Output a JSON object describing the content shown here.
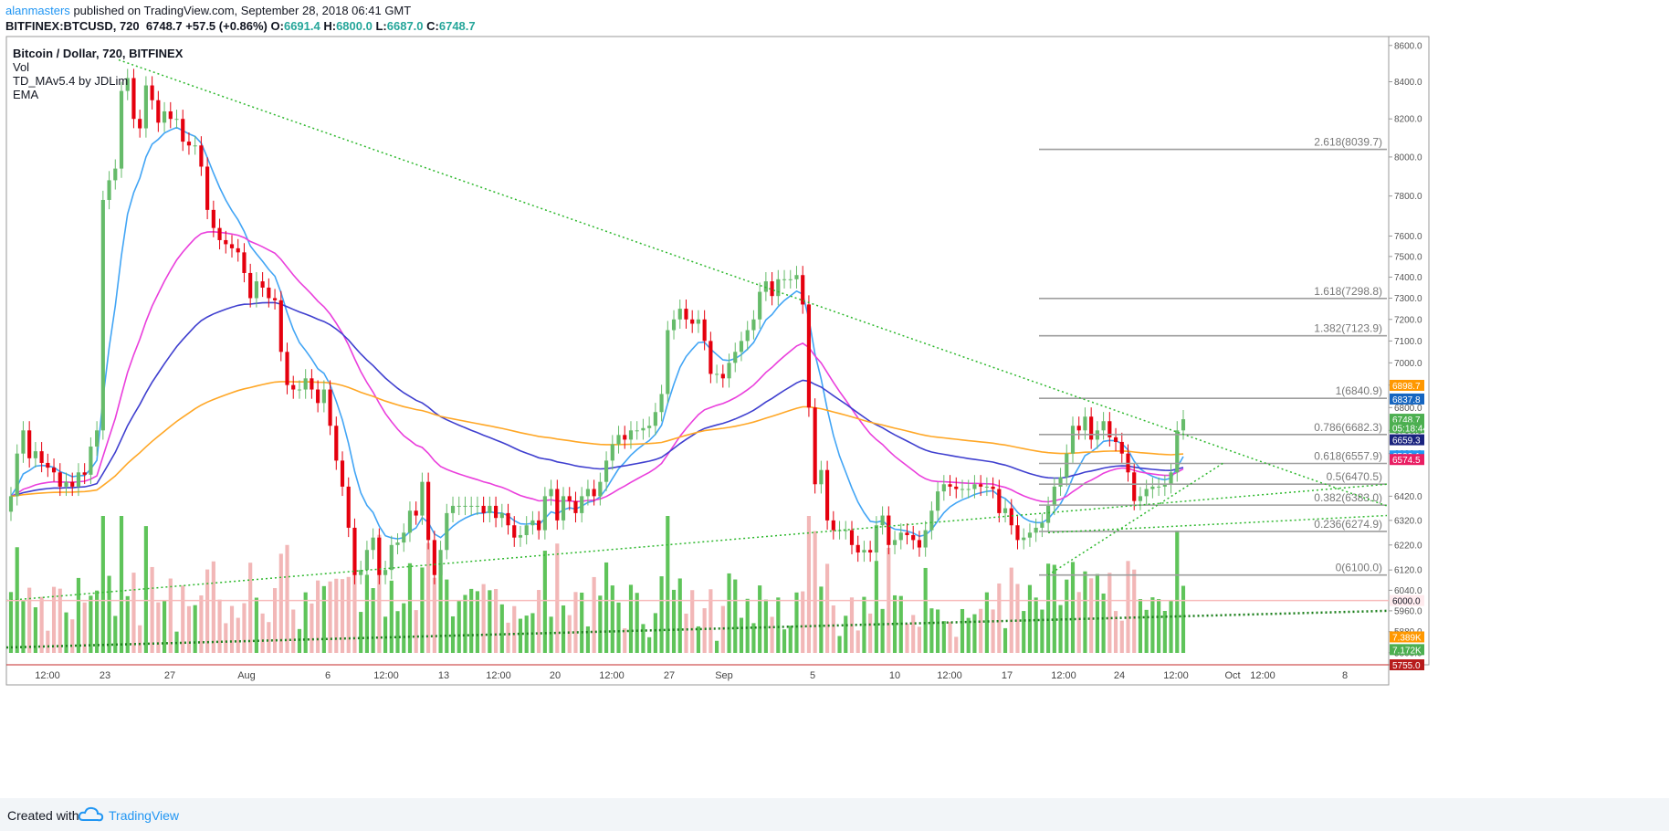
{
  "header": {
    "user": "alanmasters",
    "published": "published on TradingView.com, September 28, 2018 06:41 GMT",
    "symbol": "BITFINEX:BTCUSD, 720",
    "last": "6748.7",
    "change": "+57.5 (+0.86%)",
    "o_label": "O:",
    "o_val": "6691.4",
    "h_label": "H:",
    "h_val": "6800.0",
    "l_label": "L:",
    "l_val": "6687.0",
    "c_label": "C:",
    "c_val": "6748.7"
  },
  "legend": {
    "title": "Bitcoin / Dollar, 720, BITFINEX",
    "vol": "Vol",
    "td": "TD_MAv5.4 by JDLim",
    "ema": "EMA"
  },
  "footer": {
    "created": "Created with",
    "brand": "TradingView"
  },
  "colors": {
    "up": "#66bb6a",
    "down": "#e5000e",
    "vol_up": "#5fc45a",
    "vol_down": "#f2b7b7",
    "ema_fast": "#42a5f5",
    "ema_mid": "#ea3fdc",
    "ema_slow": "#3f3fcf",
    "ema_long": "#ffa726",
    "fib": "#9e9e9e",
    "trend": "#2eb82e"
  },
  "chart_data": {
    "type": "candlestick",
    "title": "Bitcoin / Dollar, 720, BITFINEX",
    "y_scale": "log",
    "ylim": [
      5755,
      8650
    ],
    "y_ticks": [
      8600,
      8400,
      8200,
      8000,
      7800,
      7600,
      7500,
      7400,
      7300,
      7200,
      7100,
      7000,
      6900,
      6800,
      6700,
      6600,
      6420,
      6320,
      6220,
      6120,
      6040,
      5960,
      5880,
      5800
    ],
    "x_ticks": [
      "12:00",
      "23",
      "27",
      "Aug",
      "6",
      "12:00",
      "13",
      "12:00",
      "20",
      "12:00",
      "27",
      "Sep",
      "5",
      "10",
      "12:00",
      "17",
      "12:00",
      "24",
      "12:00",
      "Oct",
      "12:00",
      "8"
    ],
    "closes": [
      6420,
      6600,
      6700,
      6580,
      6610,
      6560,
      6540,
      6520,
      6460,
      6480,
      6460,
      6520,
      6510,
      6630,
      6700,
      7780,
      7880,
      7940,
      8350,
      8420,
      8200,
      8150,
      8380,
      8300,
      8180,
      8240,
      8200,
      8200,
      8080,
      8060,
      8060,
      7950,
      7730,
      7640,
      7580,
      7560,
      7540,
      7520,
      7420,
      7300,
      7380,
      7350,
      7300,
      7290,
      7050,
      6900,
      6880,
      6880,
      6930,
      6880,
      6820,
      6880,
      6720,
      6570,
      6460,
      6290,
      6100,
      6120,
      6200,
      6250,
      6100,
      6120,
      6220,
      6230,
      6270,
      6360,
      6340,
      6480,
      6240,
      6100,
      6200,
      6350,
      6380,
      6380,
      6380,
      6380,
      6380,
      6350,
      6380,
      6330,
      6350,
      6300,
      6250,
      6260,
      6300,
      6320,
      6280,
      6420,
      6450,
      6320,
      6420,
      6400,
      6350,
      6420,
      6450,
      6420,
      6480,
      6570,
      6640,
      6680,
      6660,
      6700,
      6700,
      6710,
      6720,
      6780,
      6860,
      7150,
      7200,
      7250,
      7200,
      7180,
      7200,
      7100,
      6950,
      6950,
      6930,
      7000,
      7050,
      7100,
      7150,
      7200,
      7330,
      7380,
      7310,
      7390,
      7390,
      7390,
      7410,
      7270,
      6800,
      6470,
      6530,
      6320,
      6280,
      6280,
      6280,
      6220,
      6190,
      6200,
      6190,
      6300,
      6340,
      6220,
      6240,
      6270,
      6260,
      6240,
      6210,
      6280,
      6360,
      6440,
      6470,
      6460,
      6450,
      6450,
      6450,
      6470,
      6460,
      6460,
      6450,
      6350,
      6370,
      6300,
      6240,
      6250,
      6270,
      6290,
      6310,
      6380,
      6460,
      6500,
      6600,
      6720,
      6700,
      6760,
      6660,
      6700,
      6740,
      6670,
      6650,
      6600,
      6520,
      6400,
      6420,
      6450,
      6460,
      6460,
      6470,
      6520,
      6700,
      6748.7
    ],
    "fibonacci": [
      {
        "label": "2.618(8039.7)",
        "level": 8039.7
      },
      {
        "label": "1.618(7298.8)",
        "level": 7298.8
      },
      {
        "label": "1.382(7123.9)",
        "level": 7123.9
      },
      {
        "label": "1(6840.9)",
        "level": 6840.9
      },
      {
        "label": "0.786(6682.3)",
        "level": 6682.3
      },
      {
        "label": "0.618(6557.9)",
        "level": 6557.9
      },
      {
        "label": "0.5(6470.5)",
        "level": 6470.5
      },
      {
        "label": "0.382(6383.0)",
        "level": 6383.0
      },
      {
        "label": "0.236(6274.9)",
        "level": 6274.9
      },
      {
        "label": "0(6100.0)",
        "level": 6100.0
      }
    ],
    "price_tags": [
      {
        "text": "6898.7",
        "value": 6898.7,
        "color": "#ff9800"
      },
      {
        "text": "6837.8",
        "value": 6837.8,
        "color": "#1565c0"
      },
      {
        "text": "6748.7",
        "value": 6748.7,
        "color": "#4caf50"
      },
      {
        "text": "05:18:44",
        "value": 6712,
        "color": "#4caf50"
      },
      {
        "text": "6659.3",
        "value": 6659.3,
        "color": "#1a237e"
      },
      {
        "text": "6590.1",
        "value": 6590.1,
        "color": "#2196f3"
      },
      {
        "text": "6574.5",
        "value": 6574.5,
        "color": "#e91e63"
      },
      {
        "text": "6000.0",
        "value": 6000.0,
        "color": "#ffebee",
        "fg": "#131722"
      },
      {
        "text": "7.389K",
        "value": 5860,
        "color": "#ff9800"
      },
      {
        "text": "7.172K",
        "value": 5812,
        "color": "#4caf50"
      },
      {
        "text": "5755.0",
        "value": 5755.0,
        "color": "#b71c1c"
      }
    ],
    "ema_last": {
      "fast": 6590.1,
      "mid": 6574.5,
      "slow": 6659.3,
      "long": 6898.7
    }
  }
}
